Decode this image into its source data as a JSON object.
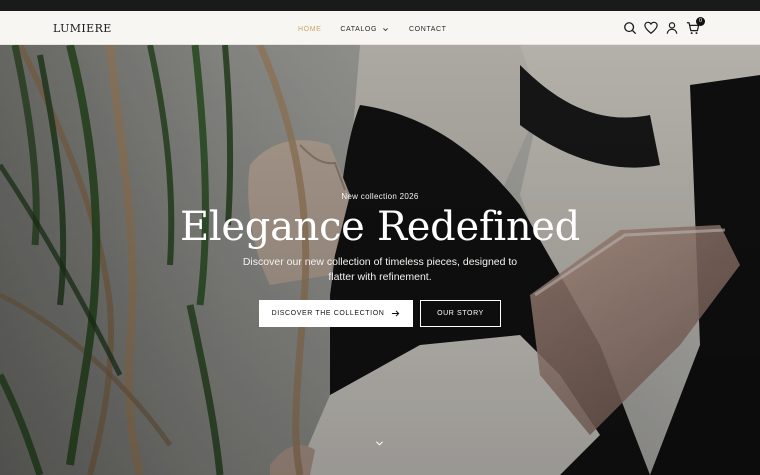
{
  "brand": {
    "logo": "LUMIERE"
  },
  "nav": {
    "items": [
      {
        "label": "HOME",
        "active": true
      },
      {
        "label": "CATALOG",
        "has_dropdown": true
      },
      {
        "label": "CONTACT"
      }
    ]
  },
  "header_icons": {
    "search": "search-icon",
    "wishlist": "heart-icon",
    "account": "user-icon",
    "cart": "cart-icon",
    "cart_count": "0"
  },
  "hero": {
    "kicker": "New collection 2026",
    "headline": "Elegance Redefined",
    "subtitle": "Discover our new collection of timeless pieces, designed to flatter with refinement.",
    "primary_cta": "DISCOVER THE COLLECTION",
    "secondary_cta": "OUR STORY",
    "scroll_icon": "chevron-down-icon"
  },
  "colors": {
    "accent": "#c9a46a",
    "header_bg": "#f7f6f3",
    "text_dark": "#1b1b1b"
  }
}
